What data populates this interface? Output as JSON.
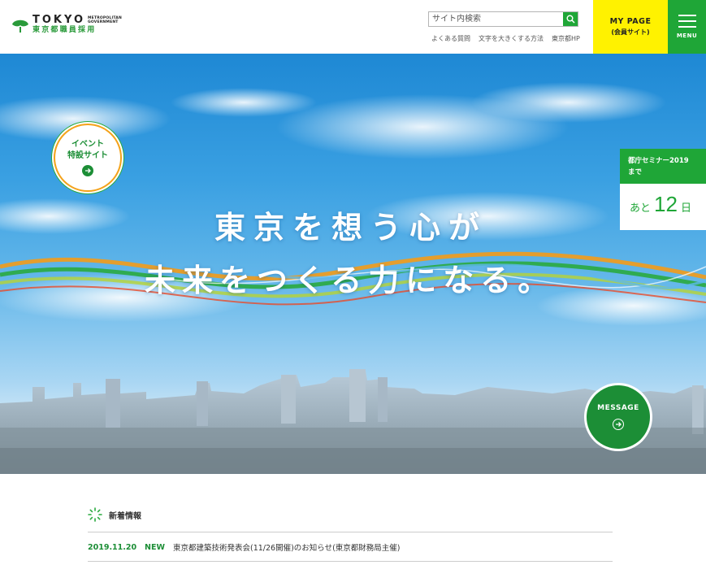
{
  "header": {
    "logo": {
      "en": "TOKYO",
      "sub1": "METROPOLITAN",
      "sub2": "GOVERNMENT",
      "jp": "東京都職員採用"
    },
    "search": {
      "placeholder": "サイト内検索"
    },
    "links": [
      "よくある質問",
      "文字を大きくする方法",
      "東京都HP"
    ],
    "mypage": {
      "title": "MY PAGE",
      "sub": "(会員サイト)"
    },
    "menu_label": "MENU"
  },
  "hero": {
    "catch_line1": "東京を想う心が",
    "catch_line2": "未来をつくる力になる。",
    "event_badge": {
      "line1": "イベント",
      "line2": "特設サイト"
    },
    "countdown": {
      "title": "都庁セミナー2019",
      "title2": "まで",
      "prefix": "あと",
      "days": "12",
      "unit": "日"
    },
    "message_label": "MESSAGE"
  },
  "news": {
    "title": "新着情報",
    "items": [
      {
        "date": "2019.11.20",
        "badge": "NEW",
        "text": "東京都建築技術発表会(11/26開催)のお知らせ(東京都財務局主催)"
      }
    ]
  },
  "colors": {
    "green": "#1fa637",
    "yellow": "#fff200",
    "sky": "#3aa0e2"
  }
}
